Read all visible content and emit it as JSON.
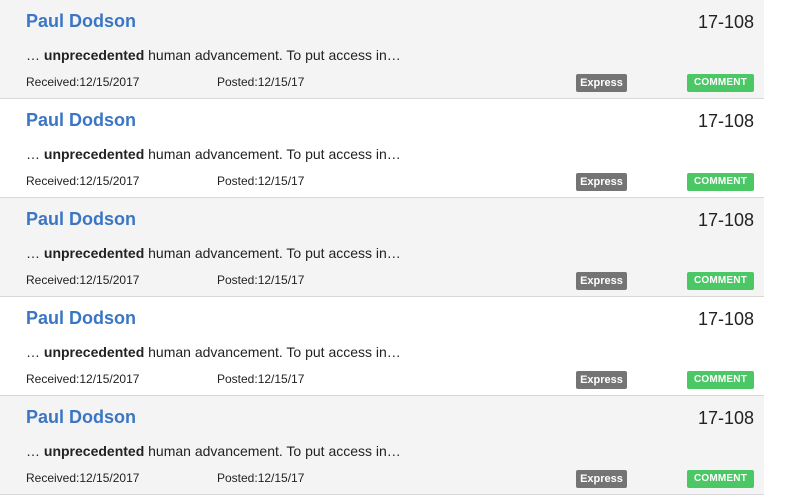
{
  "filings": [
    {
      "name": "Paul Dodson",
      "docket": "17-108",
      "snippet_prefix": "… ",
      "snippet_bold": "unprecedented",
      "snippet_rest": " human advancement. To put access in…",
      "received": "Received:12/15/2017",
      "posted": "Posted:12/15/17",
      "badge": "Express",
      "action": "COMMENT"
    },
    {
      "name": "Paul Dodson",
      "docket": "17-108",
      "snippet_prefix": "… ",
      "snippet_bold": "unprecedented",
      "snippet_rest": " human advancement. To put access in…",
      "received": "Received:12/15/2017",
      "posted": "Posted:12/15/17",
      "badge": "Express",
      "action": "COMMENT"
    },
    {
      "name": "Paul Dodson",
      "docket": "17-108",
      "snippet_prefix": "… ",
      "snippet_bold": "unprecedented",
      "snippet_rest": " human advancement. To put access in…",
      "received": "Received:12/15/2017",
      "posted": "Posted:12/15/17",
      "badge": "Express",
      "action": "COMMENT"
    },
    {
      "name": "Paul Dodson",
      "docket": "17-108",
      "snippet_prefix": "… ",
      "snippet_bold": "unprecedented",
      "snippet_rest": " human advancement. To put access in…",
      "received": "Received:12/15/2017",
      "posted": "Posted:12/15/17",
      "badge": "Express",
      "action": "COMMENT"
    },
    {
      "name": "Paul Dodson",
      "docket": "17-108",
      "snippet_prefix": "… ",
      "snippet_bold": "unprecedented",
      "snippet_rest": " human advancement. To put access in…",
      "received": "Received:12/15/2017",
      "posted": "Posted:12/15/17",
      "badge": "Express",
      "action": "COMMENT"
    }
  ],
  "colors": {
    "name_link": "#3a76c4",
    "express_badge": "#747474",
    "comment_button": "#4cc766",
    "row_alt_bg": "#f4f4f4"
  }
}
